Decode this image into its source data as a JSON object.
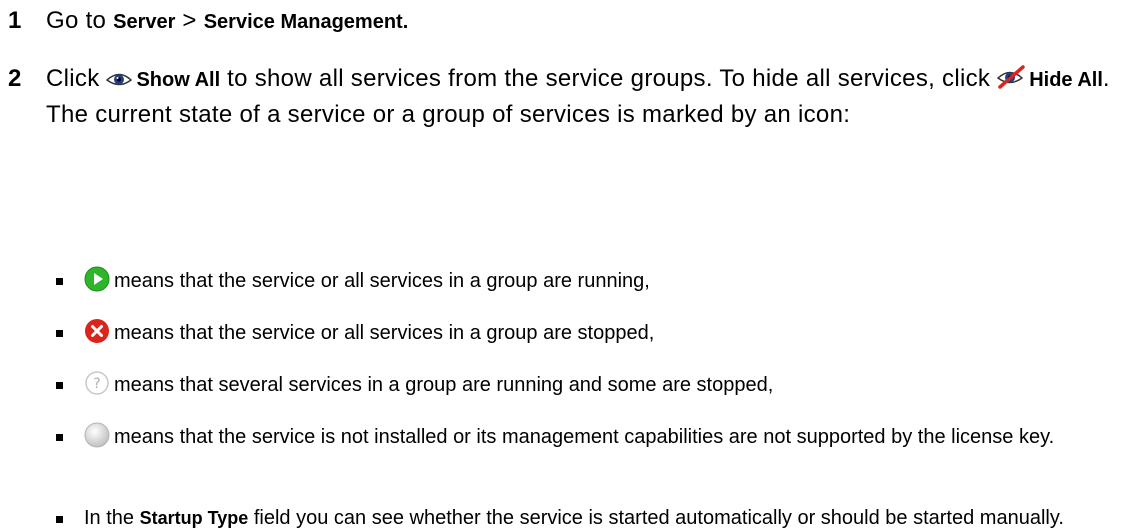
{
  "steps": [
    {
      "number": "1",
      "pre": "Go to ",
      "server": "Server",
      "sep": " > ",
      "service_mgmt": "Service Management."
    },
    {
      "number": "2",
      "pre": "Click ",
      "show_all": "Show All",
      "mid": " to show all services from the service groups. To hide all services, click ",
      "hide_all": "Hide All",
      "post": ". The current state of a service or a group of services is marked by an icon:"
    }
  ],
  "bullets": {
    "running": "means that the service or all services in a group are running,",
    "stopped": "means that the service or all services in a group are stopped,",
    "mixed": "means that several services in a group are running and some are stopped,",
    "not_installed": "means that the service is not installed or its management capabilities are not supported by the license key.",
    "startup_pre": "In the ",
    "startup_field": "Startup Type",
    "startup_post": " field you can see whether the service is started automatically or should be started manually."
  },
  "icons": {
    "running": "green-play-icon",
    "stopped": "red-x-icon",
    "mixed": "question-icon",
    "not_installed": "gray-circle-icon",
    "show_all": "eye-icon",
    "hide_all": "crossed-eye-icon"
  },
  "colors": {
    "running": "#2fb52a",
    "stopped": "#d9251c",
    "mixed_ring": "#c8c8c8",
    "not_installed": "#cfcfcf"
  }
}
